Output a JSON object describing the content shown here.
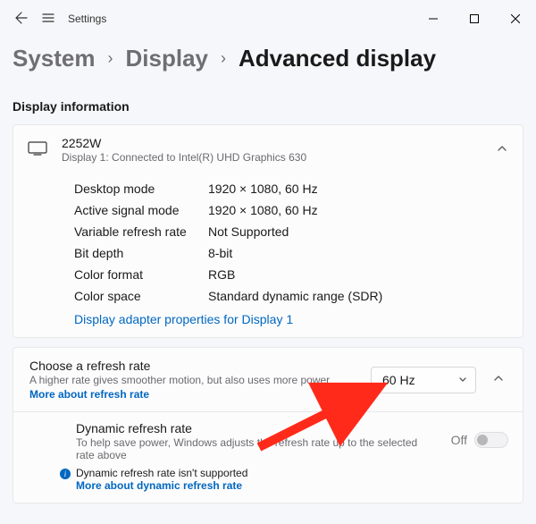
{
  "app_title": "Settings",
  "breadcrumb": {
    "lvl1": "System",
    "lvl2": "Display",
    "lvl3": "Advanced display"
  },
  "section_title": "Display information",
  "display_card": {
    "name": "2252W",
    "subtitle": "Display 1: Connected to Intel(R) UHD Graphics 630",
    "specs": [
      {
        "k": "Desktop mode",
        "v": "1920 × 1080, 60 Hz"
      },
      {
        "k": "Active signal mode",
        "v": "1920 × 1080, 60 Hz"
      },
      {
        "k": "Variable refresh rate",
        "v": "Not Supported"
      },
      {
        "k": "Bit depth",
        "v": "8-bit"
      },
      {
        "k": "Color format",
        "v": "RGB"
      },
      {
        "k": "Color space",
        "v": "Standard dynamic range (SDR)"
      }
    ],
    "adapter_link": "Display adapter properties for Display 1"
  },
  "refresh_rate": {
    "title": "Choose a refresh rate",
    "desc": "A higher rate gives smoother motion, but also uses more power",
    "more_link": "More about refresh rate",
    "selected": "60 Hz"
  },
  "dynamic": {
    "title": "Dynamic refresh rate",
    "desc": "To help save power, Windows adjusts the refresh rate up to the selected rate above",
    "note": "Dynamic refresh rate isn't supported",
    "more_link": "More about dynamic refresh rate",
    "toggle_label": "Off"
  }
}
